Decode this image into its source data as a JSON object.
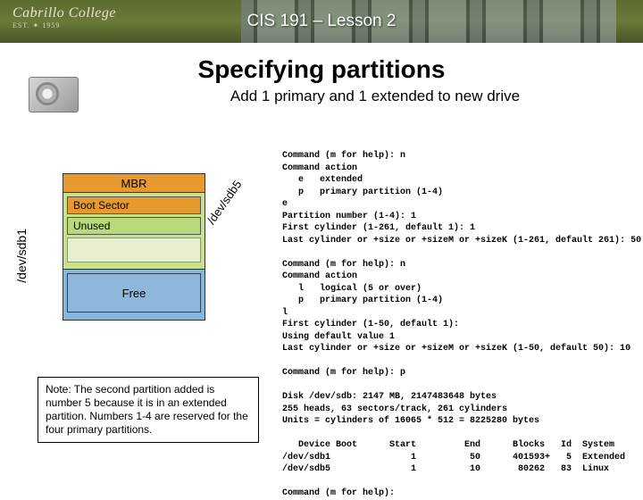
{
  "banner": {
    "logo_name": "Cabrillo College",
    "logo_est": "EST. ✦ 1959",
    "course": "CIS 191 – Lesson 2"
  },
  "headings": {
    "title": "Specifying partitions",
    "subtitle": "Add 1 primary and 1 extended to new drive"
  },
  "disk": {
    "device": "/dev/sdb1",
    "mbr": "MBR",
    "boot_sector": "Boot Sector",
    "unused": "Unused",
    "free": "Free",
    "dev5": "/dev/sdb5"
  },
  "terminal": "Command (m for help): n\nCommand action\n   e   extended\n   p   primary partition (1-4)\ne\nPartition number (1-4): 1\nFirst cylinder (1-261, default 1): 1\nLast cylinder or +size or +sizeM or +sizeK (1-261, default 261): 50\n\nCommand (m for help): n\nCommand action\n   l   logical (5 or over)\n   p   primary partition (1-4)\nl\nFirst cylinder (1-50, default 1):\nUsing default value 1\nLast cylinder or +size or +sizeM or +sizeK (1-50, default 50): 10\n\nCommand (m for help): p\n\nDisk /dev/sdb: 2147 MB, 2147483648 bytes\n255 heads, 63 sectors/track, 261 cylinders\nUnits = cylinders of 16065 * 512 = 8225280 bytes\n\n   Device Boot      Start         End      Blocks   Id  System\n/dev/sdb1               1          50      401593+   5  Extended\n/dev/sdb5               1          10       80262   83  Linux\n\nCommand (m for help):",
  "note": "Note:  The second partition added is number 5 because it is in an extended partition.  Numbers 1-4 are reserved for the four primary partitions."
}
